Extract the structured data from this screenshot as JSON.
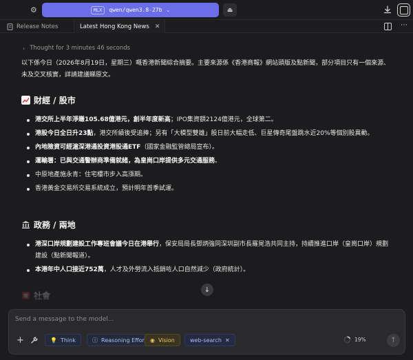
{
  "topbar": {
    "model_badge": "MLX",
    "model_name": "qwen/qwen3.8-27b",
    "accent_color": "#6a6ee8"
  },
  "tabs": [
    {
      "label": "Release Notes",
      "active": false
    },
    {
      "label": "Latest Hong Kong News",
      "active": true
    }
  ],
  "content": {
    "thought": "Thought for 3 minutes 46 seconds",
    "intro": "以下係今日（2026年8月19日，星期三）嘅香港新聞綜合摘要。主要來源係《香港商報》網站頭版及點新聞，部分項目只有一個來源、未及交叉核實，詳請建議睇原文。",
    "sections": [
      {
        "icon": "chart-icon",
        "title": "財經 / 股市",
        "items": [
          {
            "bold": "港交所上半年淨賺105.68億港元，創半年度新高",
            "rest": "；IPO集資額2124億港元，全球第二。"
          },
          {
            "bold": "港股今日全日升23點",
            "rest": "，港交所績後受追捧；另有「大模型雙雄」股日前大幅走低、巨星傳奇尾盤跳水近20%等個別股異動。"
          },
          {
            "bold": "內地險資可經滬深港通投資港股通ETF",
            "rest": "（國家金融監管總局宣布）。"
          },
          {
            "bold": "運輸署：已與交通警辦商準備就緒，為皇崗口岸提供多元交通服務",
            "rest": "。"
          },
          {
            "bold": "",
            "rest": "中原地產施永青：住宅樓市步入高漲期。"
          },
          {
            "bold": "",
            "rest": "香港黃金交易所交易系統成立，預計明年首季試運。"
          }
        ]
      },
      {
        "icon": "government-icon",
        "title": "政務 / 兩地",
        "items": [
          {
            "bold": "港深口岸規劃建設工作專班會議今日在港舉行",
            "rest": "，保安局局長鄧炳強同深圳副市長羅晃浩共同主持，持續推進口岸（皇崗口岸）規劃建設（點新聞報道）。"
          },
          {
            "bold": "本港年中人口接近752萬",
            "rest": "，人才及外勞流入抵銷咗人口自然減少（政府統計）。"
          }
        ]
      },
      {
        "icon": "society-icon",
        "title": "社會",
        "items": []
      }
    ]
  },
  "composer": {
    "placeholder": "Send a message to the model...",
    "value": "",
    "chips": [
      {
        "label": "Think",
        "icon": "bulb-icon"
      },
      {
        "label": "Reasoning Effort",
        "icon": "info-icon"
      },
      {
        "label": "Vision",
        "icon": "eye-icon"
      },
      {
        "label": "web-search",
        "icon": "close-icon"
      }
    ],
    "context_usage": "19%",
    "context_usage_fraction": 0.19
  }
}
